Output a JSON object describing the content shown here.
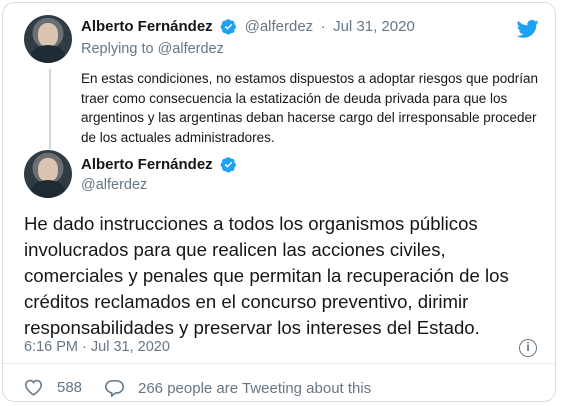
{
  "reply_tweet": {
    "author_name": "Alberto Fernández",
    "handle": "@alferdez",
    "separator": "·",
    "date": "Jul 31, 2020",
    "replying_to": "Replying to @alferdez",
    "text": "En estas condiciones, no estamos dispuestos a adoptar riesgos que podrían traer como consecuencia la estatización de deuda privada para que los argentinos y las argentinas deban hacerse cargo del irresponsable proceder de los actuales administradores."
  },
  "main_tweet": {
    "author_name": "Alberto Fernández",
    "handle": "@alferdez",
    "text": "He dado instrucciones a todos los organismos públicos involucrados para que realicen las acciones civiles, comerciales y penales que permitan la recuperación de los créditos reclamados en el concurso preventivo, dirimir responsabilidades y preservar los intereses del Estado.",
    "timestamp": "6:16 PM · Jul 31, 2020"
  },
  "stats": {
    "likes": "588",
    "people_tweeting": "266 people are Tweeting about this"
  },
  "colors": {
    "verified_blue": "#1da1f2",
    "muted_gray": "#657786",
    "text": "#14171a"
  },
  "icons": {
    "brand": "twitter-bird-icon",
    "verified": "verified-badge-icon",
    "info": "info-icon",
    "like": "heart-icon",
    "reply": "speech-bubble-icon"
  }
}
